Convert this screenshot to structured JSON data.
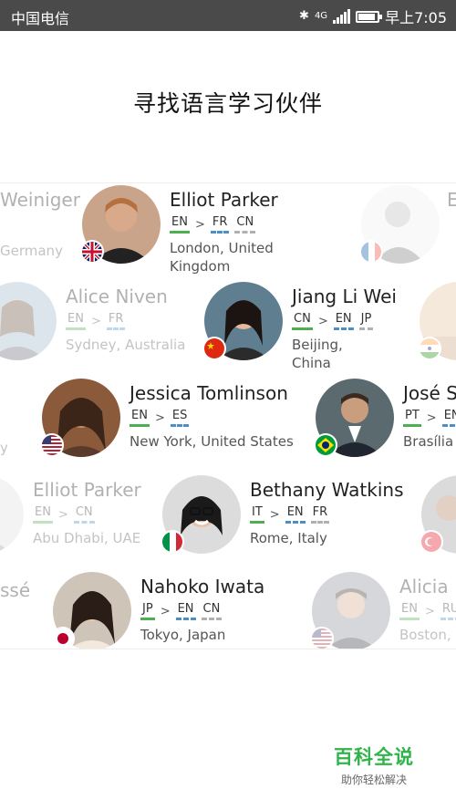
{
  "status_bar": {
    "carrier": "中国电信",
    "network": "4G",
    "time": "早上7:05"
  },
  "page": {
    "title": "寻找语言学习伙伴"
  },
  "cards": [
    {
      "id": "elliot-parker-1",
      "name": "Elliot Parker",
      "native": "EN",
      "learning": [
        "FR",
        "CN"
      ],
      "location": "London, United Kingdom",
      "flag": "uk-flag",
      "faded": false
    },
    {
      "id": "weiniger",
      "name": "Weiniger",
      "native": "",
      "learning": [],
      "location": "Germany",
      "flag": "",
      "faded": true
    },
    {
      "id": "alice-niven",
      "name": "Alice Niven",
      "native": "EN",
      "learning": [
        "FR"
      ],
      "location": "Sydney, Australia",
      "flag": "",
      "faded": true
    },
    {
      "id": "jiang-li-wei",
      "name": "Jiang Li Wei",
      "native": "CN",
      "learning": [
        "EN",
        "JP"
      ],
      "location": "Beijing, China",
      "flag": "china-flag",
      "faded": false
    },
    {
      "id": "jessica-tomlinson",
      "name": "Jessica Tomlinson",
      "native": "EN",
      "learning": [
        "ES"
      ],
      "location": "New York, United States",
      "flag": "usa-flag",
      "faded": false
    },
    {
      "id": "jose",
      "name": "José S",
      "native": "PT",
      "learning": [
        "EN"
      ],
      "location": "Brasília",
      "flag": "brazil-flag",
      "faded": false
    },
    {
      "id": "elliot-parker-2",
      "name": "Elliot Parker",
      "native": "EN",
      "learning": [
        "CN"
      ],
      "location": "Abu Dhabi, UAE",
      "flag": "",
      "faded": true
    },
    {
      "id": "bethany-watkins",
      "name": "Bethany Watkins",
      "native": "IT",
      "learning": [
        "EN",
        "FR"
      ],
      "location": "Rome, Italy",
      "flag": "italy-flag",
      "faded": false
    },
    {
      "id": "nahoko-iwata",
      "name": "Nahoko Iwata",
      "native": "JP",
      "learning": [
        "EN",
        "CN"
      ],
      "location": "Tokyo, Japan",
      "flag": "japan-flag",
      "faded": false
    },
    {
      "id": "alicia",
      "name": "Alicia",
      "native": "EN",
      "learning": [
        "RU"
      ],
      "location": "Boston,",
      "flag": "usa-flag",
      "faded": true
    }
  ],
  "edge_fragments": {
    "row1_right": "E",
    "row4_left": "y",
    "row5_left": "ssé"
  },
  "watermark": {
    "title": "百科全说",
    "subtitle": "助你轻松解决"
  },
  "colors": {
    "native_underline": "#4caf50",
    "learning_underline": "#4b8fc7",
    "status_bar_bg": "#4a4a4a",
    "watermark_green": "#2fb34a"
  }
}
